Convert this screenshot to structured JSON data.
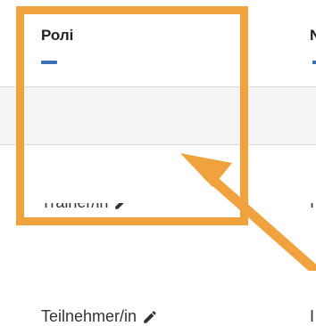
{
  "table": {
    "columns": [
      {
        "label": "Ролі"
      },
      {
        "label": "N"
      }
    ],
    "rows": [
      {
        "role": "Trainer/in",
        "right_partial": "I"
      },
      {
        "role": "Teilnehmer/in",
        "right_partial": "I"
      }
    ]
  },
  "colors": {
    "accent": "#3d6fb6",
    "highlight": "#f0a23e",
    "row_alt_bg": "#f5f5f5",
    "divider": "#dcdcdc"
  },
  "icons": {
    "edit": "pencil-icon"
  }
}
